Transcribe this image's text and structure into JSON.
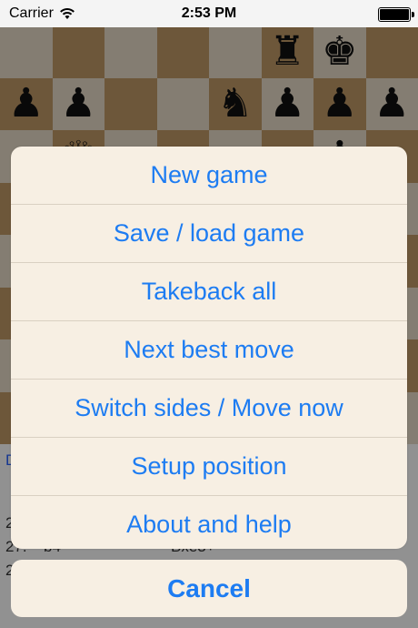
{
  "status_bar": {
    "carrier": "Carrier",
    "time": "2:53 PM"
  },
  "board": {
    "rank8": [
      "",
      "",
      "",
      "",
      "",
      "♜",
      "♚",
      ""
    ],
    "rank7": [
      "♟",
      "♟",
      "",
      "",
      "♞",
      "♟",
      "♟",
      "♟"
    ],
    "rank6": [
      "",
      "♕",
      "",
      "",
      "",
      "",
      "♝",
      ""
    ],
    "rank5": [
      "",
      "",
      "",
      "",
      "",
      "",
      "",
      ""
    ],
    "rank4": [
      "",
      "",
      "",
      "",
      "",
      "",
      "",
      ""
    ],
    "rank3": [
      "",
      "",
      "",
      "",
      "",
      "",
      "",
      ""
    ],
    "rank2": [
      "",
      "",
      "",
      "",
      "",
      "",
      "",
      ""
    ],
    "rank1": [
      "",
      "",
      "",
      "",
      "",
      "",
      "",
      ""
    ]
  },
  "game": {
    "status_fragment": "D",
    "moves": [
      {
        "num": "2",
        "white": "",
        "black": ""
      },
      {
        "num": "27.",
        "white": "b4",
        "black": "Bxe3+"
      },
      {
        "num": "2",
        "white": "",
        "black": ""
      }
    ]
  },
  "action_sheet": {
    "items": [
      "New game",
      "Save / load game",
      "Takeback all",
      "Next best move",
      "Switch sides / Move now",
      "Setup position",
      "About and help"
    ],
    "cancel": "Cancel"
  }
}
